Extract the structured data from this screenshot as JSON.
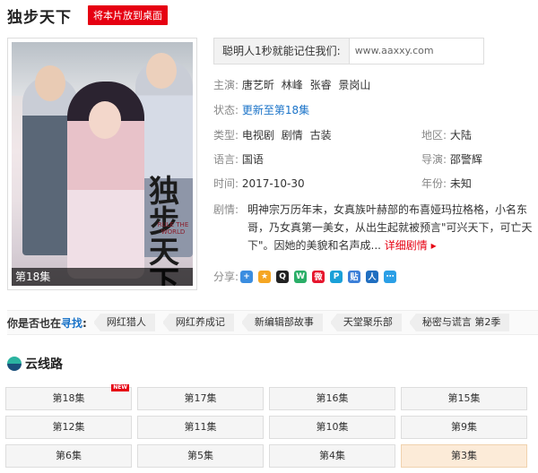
{
  "title": "独步天下",
  "desktop_button": "将本片放到桌面",
  "poster": {
    "calligraphy": "独步天下",
    "subtitle": "RULE THE WORLD",
    "badge": "第18集"
  },
  "remember": {
    "label": "聪明人1秒就能记住我们:",
    "url": "www.aaxxy.com"
  },
  "info": {
    "cast_label": "主演:",
    "cast": [
      "唐艺昕",
      "林峰",
      "张睿",
      "景岗山"
    ],
    "status_label": "状态:",
    "status": "更新至第18集",
    "type_label": "类型:",
    "types": [
      "电视剧",
      "剧情",
      "古装"
    ],
    "region_label": "地区:",
    "region": "大陆",
    "language_label": "语言:",
    "language": "国语",
    "director_label": "导演:",
    "director": "邵警辉",
    "time_label": "时间:",
    "time": "2017-10-30",
    "year_label": "年份:",
    "year": "未知",
    "plot_label": "剧情:",
    "plot": "明神宗万历年末，女真族叶赫部的布喜娅玛拉格格，小名东哥，乃女真第一美女，从出生起就被预言\"可兴天下，可亡天下\"。因她的美貌和名声成...",
    "plot_more": "详细剧情",
    "share_label": "分享:"
  },
  "share_icons": [
    {
      "name": "plus-share-icon",
      "glyph": "+",
      "color": "#3b8de0"
    },
    {
      "name": "qzone-icon",
      "glyph": "★",
      "color": "#f5a623"
    },
    {
      "name": "qq-icon",
      "glyph": "Q",
      "color": "#222222"
    },
    {
      "name": "wechat-icon",
      "glyph": "W",
      "color": "#2aae67"
    },
    {
      "name": "weibo-icon",
      "glyph": "微",
      "color": "#e6162d"
    },
    {
      "name": "pinterest-icon",
      "glyph": "P",
      "color": "#1aa0d8"
    },
    {
      "name": "tieba-icon",
      "glyph": "贴",
      "color": "#3b7fd8"
    },
    {
      "name": "renren-icon",
      "glyph": "人",
      "color": "#1f6ec0"
    },
    {
      "name": "more-share-icon",
      "glyph": "⋯",
      "color": "#2b9fe6"
    }
  ],
  "find": {
    "label_prefix": "你是否也在",
    "label_highlight": "寻找",
    "label_suffix": ":",
    "tags": [
      "网红猎人",
      "网红养成记",
      "新编辑部故事",
      "天堂聚乐部",
      "秘密与谎言 第2季"
    ]
  },
  "cloud": {
    "title": "云线路"
  },
  "episodes": [
    {
      "label": "第18集",
      "new": true,
      "active": false
    },
    {
      "label": "第17集",
      "new": false,
      "active": false
    },
    {
      "label": "第16集",
      "new": false,
      "active": false
    },
    {
      "label": "第15集",
      "new": false,
      "active": false
    },
    {
      "label": "第12集",
      "new": false,
      "active": false
    },
    {
      "label": "第11集",
      "new": false,
      "active": false
    },
    {
      "label": "第10集",
      "new": false,
      "active": false
    },
    {
      "label": "第9集",
      "new": false,
      "active": false
    },
    {
      "label": "第6集",
      "new": false,
      "active": false
    },
    {
      "label": "第5集",
      "new": false,
      "active": false
    },
    {
      "label": "第4集",
      "new": false,
      "active": false
    },
    {
      "label": "第3集",
      "new": false,
      "active": true
    }
  ],
  "new_badge": "NEW"
}
